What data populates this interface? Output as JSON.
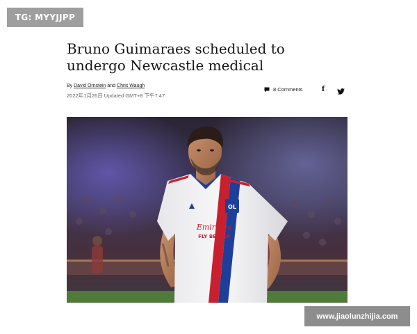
{
  "tag_badge": "TG: MYYJJPP",
  "article": {
    "headline": "Bruno Guimaraes scheduled to undergo Newcastle medical",
    "byline": {
      "prefix": "By",
      "author1": "David Ornstein",
      "joiner": "and",
      "author2": "Chris Waugh"
    },
    "dateline": "2022年1月26日 Updated GMT+8 下午7:47",
    "comments_label": "8 Comments",
    "share_facebook_glyph": "f"
  },
  "hero_image": {
    "jersey_sponsor_line1": "Emirates",
    "jersey_sponsor_line2": "FLY BETTER",
    "crest_text": "OL"
  },
  "watermark": "www.jiaolunzhijia.com",
  "colors": {
    "badge_bg": "#9e9e9e",
    "watermark_bg": "#8d8d8d",
    "jersey_red": "#c8202f",
    "jersey_blue": "#1d3f9a"
  },
  "icons": [
    "comment-icon",
    "facebook-icon",
    "twitter-icon"
  ]
}
